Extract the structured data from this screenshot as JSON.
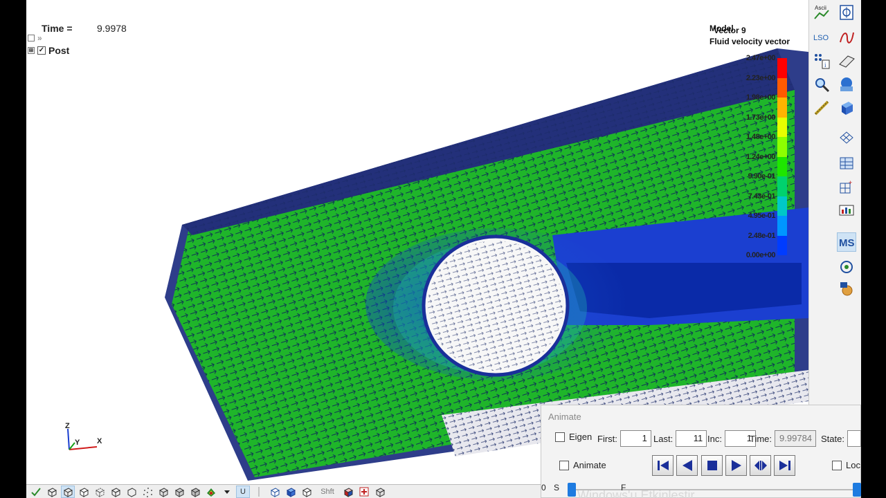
{
  "hud": {
    "time_label": "Time =",
    "time_value": "9.9978"
  },
  "tree": {
    "expand_symbol": "⊞",
    "chevron": "»",
    "check_symbol": "☑",
    "post_label": "Post"
  },
  "legend": {
    "title_line1": "Model",
    "title_line2": "Vector 9",
    "title_line3": "Fluid velocity vector",
    "labels": [
      "2.47e+00",
      "2.23e+00",
      "1.98e+00",
      "1.73e+00",
      "1.48e+00",
      "1.24e+00",
      "9.90e-01",
      "7.43e-01",
      "4.95e-01",
      "2.48e-01",
      "0.00e+00"
    ],
    "colors": [
      "#ff0000",
      "#ff5a00",
      "#ffb400",
      "#e6ff00",
      "#8cff00",
      "#1ee600",
      "#00d26e",
      "#00c8c8",
      "#0096ff",
      "#003cff"
    ]
  },
  "axes": {
    "z": "Z",
    "y": "Y",
    "x": "X"
  },
  "right_toolbar": {
    "items": [
      "ascii-icon",
      "property-icon",
      "lso-icon",
      "curve-icon",
      "list-info-icon",
      "surface-icon",
      "find-icon",
      "sphere-icon",
      "measure-icon",
      "box-icon",
      "mesh-icon",
      "grid-icon",
      "element-icon",
      "chart-icon",
      "ms-icon",
      "node-icon",
      "settings-icon"
    ],
    "ascii_label": "Ascii",
    "lso_label": "LSO",
    "ms_label": "MS"
  },
  "bottom_toolbar": {
    "shft_label": "Shft",
    "u_label": "U"
  },
  "animate": {
    "title": "Animate",
    "eigen_label": "Eigen",
    "first_label": "First:",
    "first_value": "1",
    "last_label": "Last:",
    "last_value": "11",
    "inc_label": "Inc:",
    "inc_value": "1",
    "time_label": "Time:",
    "time_value": "9.99784",
    "state_label": "State:",
    "animate_label": "Animate",
    "lock_label": "Loc",
    "s_zero": "0",
    "s_label": "S",
    "f_label": "F",
    "watermark": "Windows'u Etkinleştir"
  }
}
